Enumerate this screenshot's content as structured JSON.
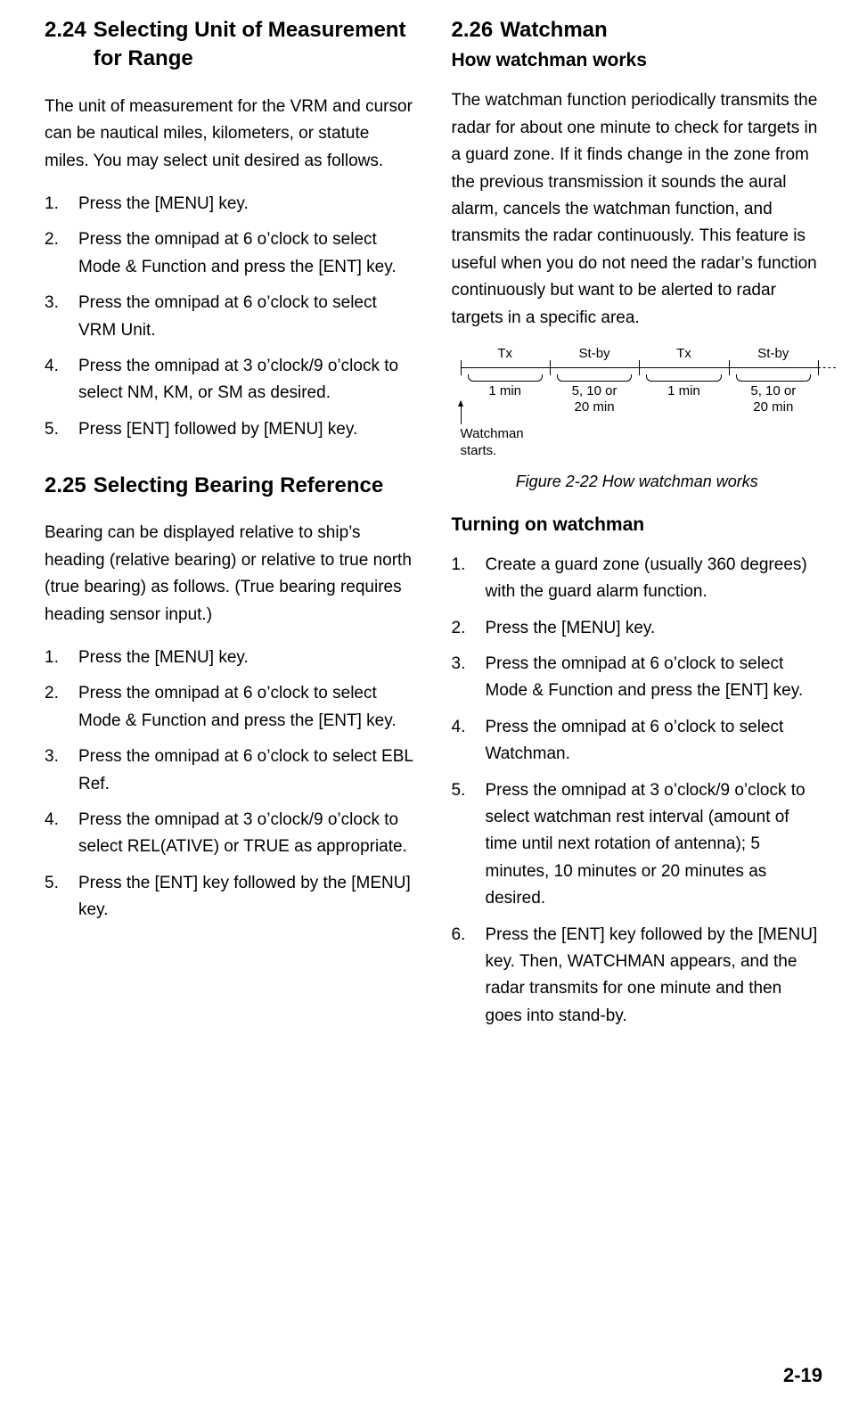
{
  "page_number": "2-19",
  "left": {
    "sec224": {
      "num": "2.24",
      "title": "Selecting Unit of Measurement for Range",
      "intro": "The unit of measurement for the VRM and cursor can be nautical miles, kilometers, or statute miles. You may select unit desired as follows.",
      "steps": [
        "Press the [MENU] key.",
        "Press the omnipad at 6 o’clock to select Mode & Function and press the [ENT] key.",
        "Press the omnipad at 6 o’clock to select VRM Unit.",
        "Press the omnipad at 3 o’clock/9 o’clock to select NM, KM, or SM as desired.",
        "Press [ENT] followed by [MENU] key."
      ]
    },
    "sec225": {
      "num": "2.25",
      "title": "Selecting Bearing Reference",
      "intro": "Bearing can be displayed relative to ship’s heading (relative bearing) or relative to true north (true bearing) as follows. (True bearing requires heading sensor input.)",
      "steps": [
        "Press the [MENU] key.",
        "Press the omnipad at 6 o’clock to select Mode & Function and press the [ENT] key.",
        "Press the omnipad at 6 o’clock to select EBL Ref.",
        "Press the omnipad at 3 o’clock/9 o’clock to select REL(ATIVE) or TRUE as appropriate.",
        "Press the [ENT] key followed by the [MENU] key."
      ]
    }
  },
  "right": {
    "sec226": {
      "num": "2.26",
      "title": "Watchman",
      "sub1": {
        "heading": "How watchman works",
        "body": "The watchman function periodically transmits the radar for about one minute to check for targets in a guard zone. If it finds change in the zone from the previous transmission it sounds the aural alarm, cancels the watchman function, and transmits the radar continuously. This feature is useful when you do not need the radar’s function continuously but want to be alerted to radar targets in a specific area."
      },
      "figure": {
        "caption": "Figure 2-22 How watchman works",
        "top": [
          "Tx",
          "St-by",
          "Tx",
          "St-by"
        ],
        "bottom": [
          "1 min",
          "5, 10 or\n20 min",
          "1 min",
          "5, 10 or\n20 min"
        ],
        "arrow_label": "Watchman\nstarts."
      },
      "sub2": {
        "heading": "Turning on watchman",
        "steps": [
          "Create a guard zone (usually 360 degrees) with the guard alarm function.",
          "Press the [MENU] key.",
          "Press the omnipad at 6 o’clock to select Mode & Function and press the [ENT] key.",
          "Press the omnipad at 6 o’clock to select Watchman.",
          "Press the omnipad at 3 o’clock/9 o’clock to select watchman rest interval (amount of time until next rotation of antenna); 5 minutes, 10 minutes or 20 minutes as desired.",
          "Press the [ENT] key followed by the [MENU] key. Then, WATCHMAN appears, and the radar transmits for one minute and then goes into stand-by."
        ]
      }
    }
  }
}
